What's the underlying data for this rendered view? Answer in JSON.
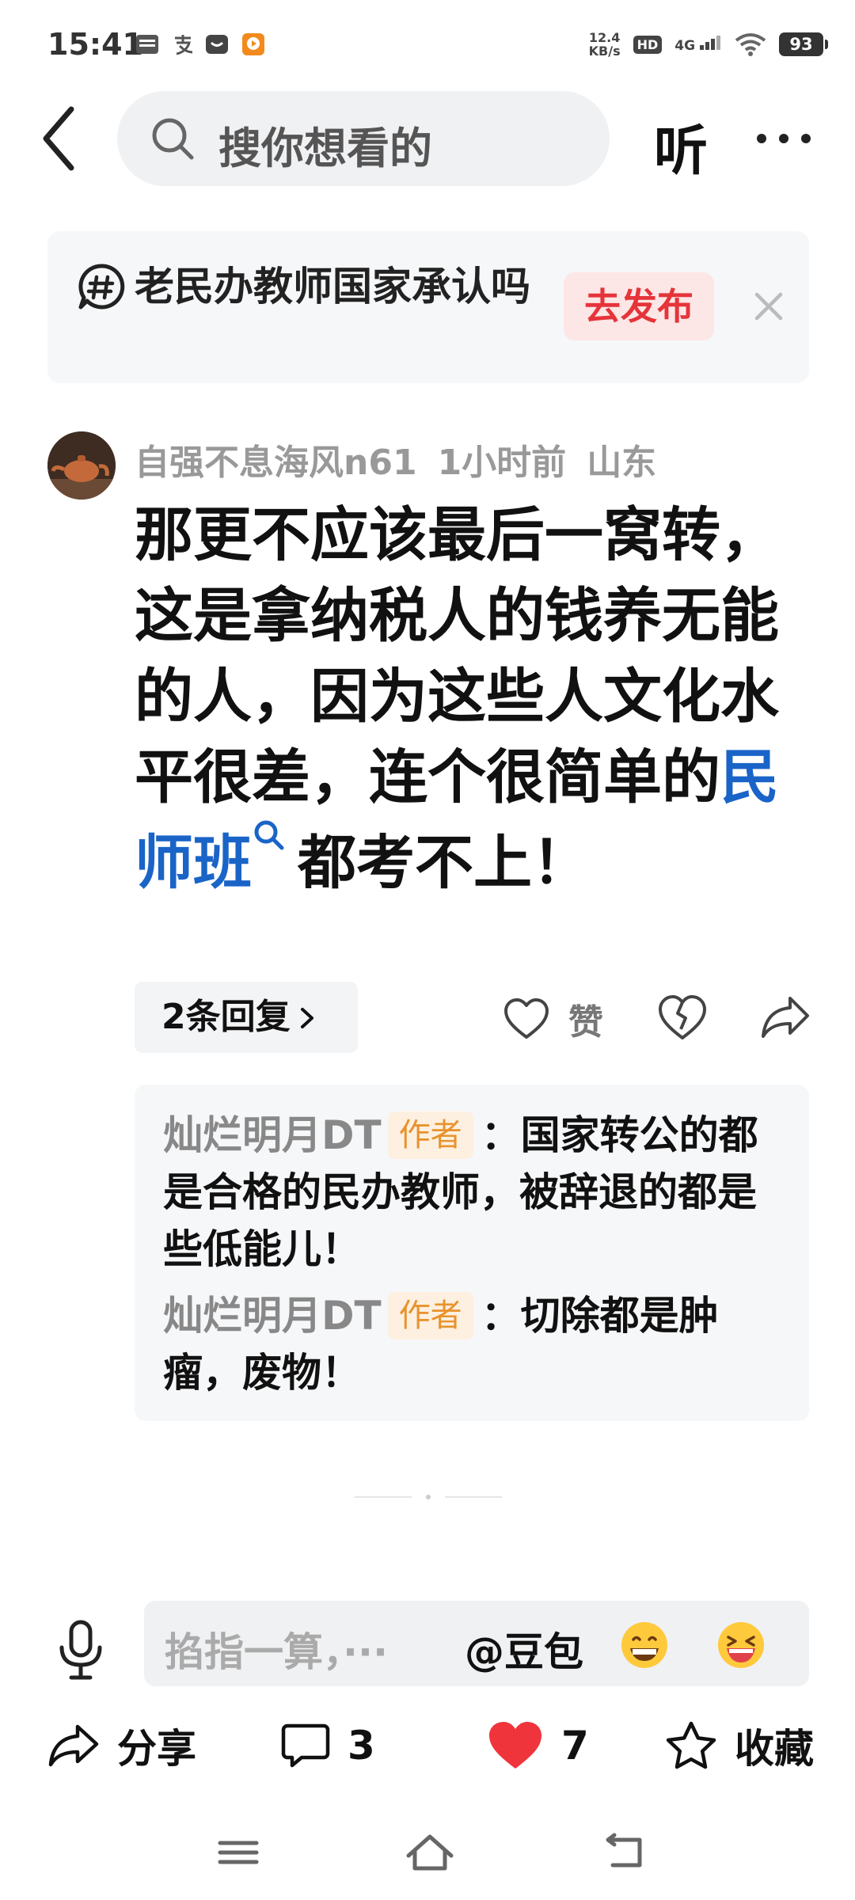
{
  "status_bar": {
    "time": "15:41",
    "network_speed_value": "12.4",
    "network_speed_unit": "KB/s",
    "hd_label": "HD",
    "network_type": "4G",
    "battery": "93",
    "notification_icons": [
      "toutiao-icon",
      "alipay-icon",
      "message-icon",
      "video-app-icon"
    ]
  },
  "header": {
    "search_placeholder": "搜你想看的",
    "listen_label": "听"
  },
  "topic": {
    "text": "老民办教师国家承认吗",
    "publish_label": "去发布"
  },
  "comment": {
    "username": "自强不息海风n61",
    "time": "1小时前",
    "location": "山东",
    "text_before": "那更不应该最后一窝转，这是拿纳税人的钱养无能的人，因为这些人文化水平很差，连个很简单的",
    "keyword": "民师班",
    "text_after": "都考不上！",
    "replies_label": "2条回复",
    "like_label": "赞"
  },
  "replies": [
    {
      "name": "灿烂明月DT",
      "tag": "作者",
      "text": "：国家转公的都是合格的民办教师，被辞退的都是些低能儿！"
    },
    {
      "name": "灿烂明月DT",
      "tag": "作者",
      "text": "：切除都是肿瘤，废物！"
    }
  ],
  "input": {
    "placeholder": "掐指一算，···",
    "mention": "@豆包"
  },
  "actions": {
    "share_label": "分享",
    "comment_count": "3",
    "like_count": "7",
    "favorite_label": "收藏"
  },
  "colors": {
    "keyword_blue": "#1a64c8",
    "publish_red": "#e5343a",
    "heart_red": "#f0343c",
    "author_tag_orange": "#e8932e"
  }
}
